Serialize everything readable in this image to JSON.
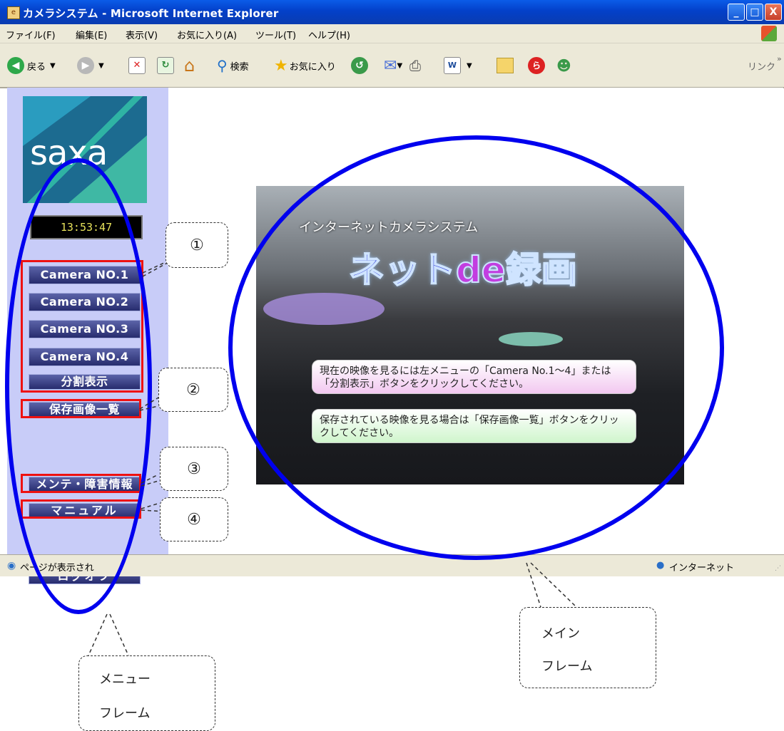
{
  "window": {
    "title": "カメラシステム - Microsoft Internet Explorer",
    "buttons": {
      "minimize": "_",
      "maximize": "□",
      "close": "X"
    }
  },
  "menubar": [
    "ファイル(F)",
    "編集(E)",
    "表示(V)",
    "お気に入り(A)",
    "ツール(T)",
    "ヘルプ(H)"
  ],
  "toolbar": {
    "back_label": "戻る",
    "search_label": "検索",
    "favorites_label": "お気に入り",
    "links_label": "リンク"
  },
  "menu_frame": {
    "logo_text": "saxa",
    "clock": "13:53:47",
    "buttons": {
      "camera1": "Camera NO.1",
      "camera2": "Camera NO.2",
      "camera3": "Camera NO.3",
      "camera4": "Camera NO.4",
      "split_view": "分割表示",
      "saved_images": "保存画像一覧",
      "maintenance": "メンテ・障害情報",
      "manual": "マニュアル",
      "logoff": "ログオフ"
    }
  },
  "main_frame": {
    "hero_subtitle": "インターネットカメラシステム",
    "hero_title_a": "ネット",
    "hero_title_de": "de",
    "hero_title_b": "録画",
    "message1": "現在の映像を見るには左メニューの「Camera No.1～4」または「分割表示」ボタンをクリックしてください。",
    "message2": "保存されている映像を見る場合は「保存画像一覧」ボタンをクリックしてください。"
  },
  "statusbar": {
    "left": "ページが表示され",
    "zone": "インターネット"
  },
  "annotations": {
    "n1": "①",
    "n2": "②",
    "n3": "③",
    "n4": "④",
    "main_frame_label_1": "メイン",
    "main_frame_label_2": "フレーム",
    "menu_frame_label_1": "メニュー",
    "menu_frame_label_2": "フレーム"
  },
  "colors": {
    "annotation_ellipse": "#0000ee",
    "annotation_box": "#ee1111",
    "menu_frame_bg": "#c8ccf8"
  }
}
